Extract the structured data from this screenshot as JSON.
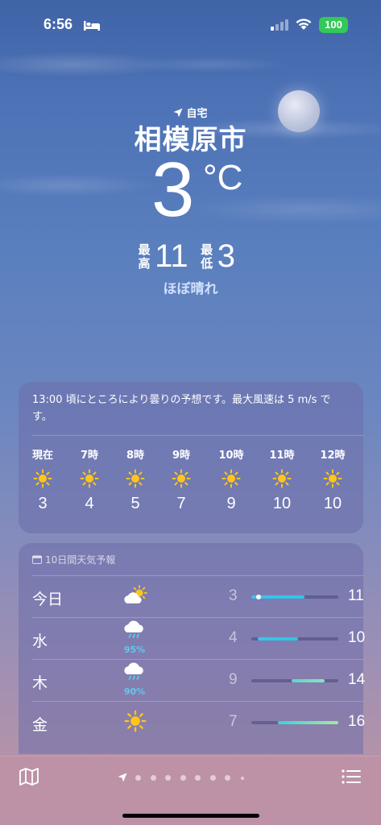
{
  "status": {
    "time": "6:56",
    "battery": "100",
    "icons": [
      "bed-icon",
      "signal-icon",
      "wifi-icon"
    ]
  },
  "location": {
    "label": "自宅",
    "city": "相模原市",
    "temperature": "3",
    "unit": "°C",
    "high_label": "最高",
    "high": "11",
    "low_label": "最低",
    "low": "3",
    "condition": "ほぼ晴れ"
  },
  "hourly": {
    "summary": "13:00 頃にところにより曇りの予想です。最大風速は 5 m/s です。",
    "items": [
      {
        "label": "現在",
        "icon": "sun-icon",
        "temp": "3"
      },
      {
        "label": "7時",
        "icon": "sun-icon",
        "temp": "4"
      },
      {
        "label": "8時",
        "icon": "sun-icon",
        "temp": "5"
      },
      {
        "label": "9時",
        "icon": "sun-icon",
        "temp": "7"
      },
      {
        "label": "10時",
        "icon": "sun-icon",
        "temp": "9"
      },
      {
        "label": "11時",
        "icon": "sun-icon",
        "temp": "10"
      },
      {
        "label": "12時",
        "icon": "sun-icon",
        "temp": "10"
      }
    ]
  },
  "daily": {
    "header": "10日間天気予報",
    "scale_min": 3,
    "scale_max": 16,
    "items": [
      {
        "day": "今日",
        "icon": "partly-cloudy-icon",
        "prob": "",
        "low": "3",
        "high": "11",
        "low_v": 3,
        "high_v": 11,
        "current_v": 3,
        "colors": [
          "#39c3f0",
          "#2fc6e8"
        ]
      },
      {
        "day": "水",
        "icon": "rain-icon",
        "prob": "95%",
        "low": "4",
        "high": "10",
        "low_v": 4,
        "high_v": 10,
        "current_v": null,
        "colors": [
          "#34c8ee",
          "#2bc7df"
        ]
      },
      {
        "day": "木",
        "icon": "rain-icon",
        "prob": "90%",
        "low": "9",
        "high": "14",
        "low_v": 9,
        "high_v": 14,
        "current_v": null,
        "colors": [
          "#5dd6c8",
          "#8ee0c0"
        ]
      },
      {
        "day": "金",
        "icon": "sun-icon",
        "prob": "",
        "low": "7",
        "high": "16",
        "low_v": 7,
        "high_v": 16,
        "current_v": null,
        "colors": [
          "#3fcfd9",
          "#a8e6a2"
        ]
      }
    ]
  },
  "bottom": {
    "icons": [
      "map-icon",
      "location-arrow-icon",
      "list-icon"
    ],
    "page_count": 8
  }
}
